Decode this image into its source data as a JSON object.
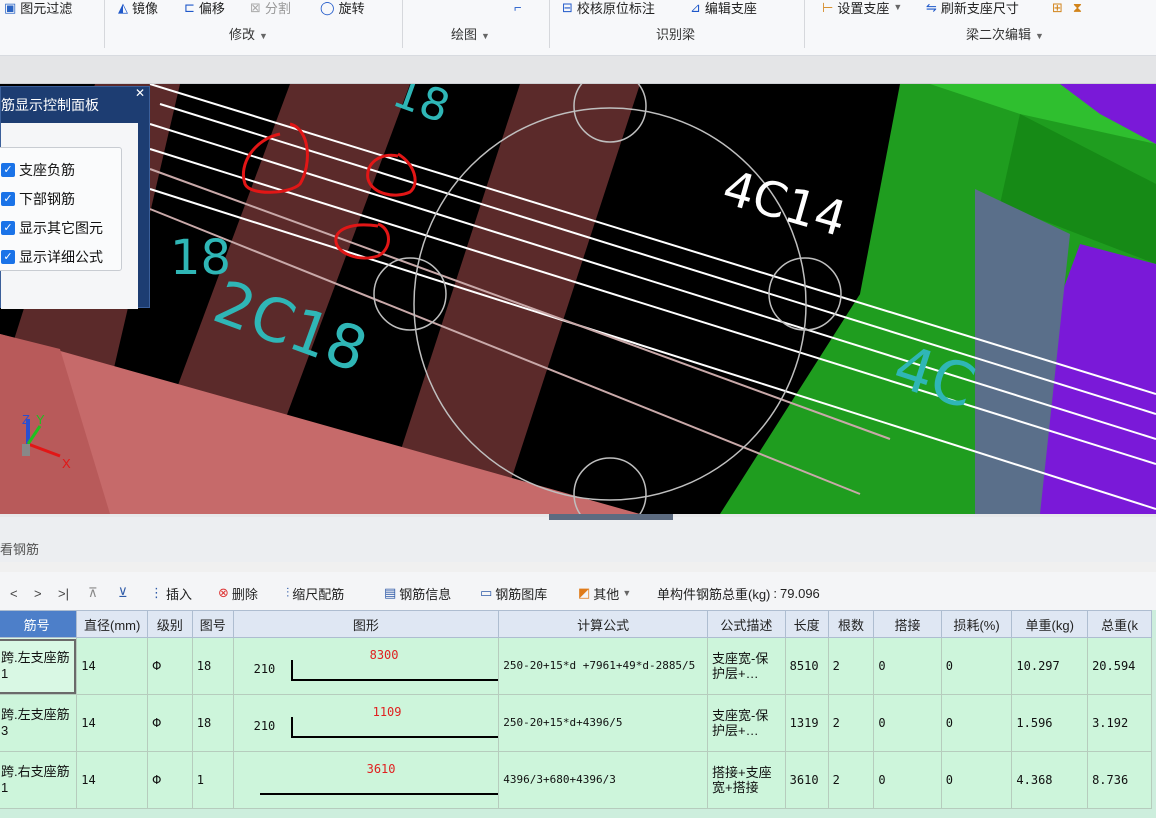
{
  "ribbon": {
    "items": [
      {
        "label": "图元过滤",
        "icon": "filter-icon"
      },
      {
        "label": "镜像",
        "icon": "mirror-icon"
      },
      {
        "label": "偏移",
        "icon": "offset-icon"
      },
      {
        "label": "分割",
        "icon": "split-icon"
      },
      {
        "label": "旋转",
        "icon": "rotate-icon"
      },
      {
        "label": "校核原位标注",
        "icon": "check-label-icon"
      },
      {
        "label": "编辑支座",
        "icon": "edit-support-icon"
      },
      {
        "label": "设置支座",
        "icon": "set-support-icon"
      },
      {
        "label": "刷新支座尺寸",
        "icon": "refresh-support-icon"
      }
    ],
    "groups": {
      "modify": "修改",
      "draw": "绘图",
      "identify_beam": "识别梁",
      "beam_secondary_edit": "梁二次编辑"
    }
  },
  "viewport": {
    "labels": {
      "main_rebar": "4C14",
      "rebar_left_1": "18",
      "rebar_left_2": "2C18",
      "rebar_right": "4C",
      "rebar_top": "18"
    },
    "axes": {
      "x": "X",
      "y": "Y",
      "z": "Z"
    },
    "colors": {
      "background": "#000000",
      "beam_pink": "#c66a6a",
      "column_brown": "#5b2a2a",
      "green_slab": "#1f9d1f",
      "purple_slab": "#7a19d8",
      "rebar_cyan": "#2fb6b6",
      "annotation_red": "#e21616"
    }
  },
  "control_panel": {
    "title": "筋显示控制面板",
    "checkboxes": [
      {
        "label": "支座负筋",
        "checked": true
      },
      {
        "label": "下部钢筋",
        "checked": true
      },
      {
        "label": "显示其它图元",
        "checked": true
      },
      {
        "label": "显示详细公式",
        "checked": true
      }
    ]
  },
  "lower_panel": {
    "title": "看钢筋"
  },
  "toolbar2": {
    "nav": [
      "<",
      ">",
      ">|"
    ],
    "insert": "插入",
    "delete": "删除",
    "scale_rebar": "缩尺配筋",
    "rebar_info": "钢筋信息",
    "rebar_library": "钢筋图库",
    "other": "其他",
    "total_weight_label": "单构件钢筋总重(kg)",
    "total_weight_value": "79.096"
  },
  "table": {
    "headers": [
      "筋号",
      "直径(mm)",
      "级别",
      "图号",
      "图形",
      "计算公式",
      "公式描述",
      "长度",
      "根数",
      "搭接",
      "损耗(%)",
      "单重(kg)",
      "总重(k"
    ],
    "rows": [
      {
        "name": "跨.左支座筋1",
        "diameter": "14",
        "grade": "Φ",
        "fig": "18",
        "shape_left": "210",
        "shape_mid": "8300",
        "formula": "250-20+15*d +7961+49*d-2885/5",
        "desc": "支座宽-保护层+…",
        "length": "8510",
        "count": "2",
        "lap": "0",
        "loss": "0",
        "unit_wt": "10.297",
        "total_wt": "20.594"
      },
      {
        "name": "跨.左支座筋3",
        "diameter": "14",
        "grade": "Φ",
        "fig": "18",
        "shape_left": "210",
        "shape_mid": "1109",
        "formula": "250-20+15*d+4396/5",
        "desc": "支座宽-保护层+…",
        "length": "1319",
        "count": "2",
        "lap": "0",
        "loss": "0",
        "unit_wt": "1.596",
        "total_wt": "3.192"
      },
      {
        "name": "跨.右支座筋1",
        "diameter": "14",
        "grade": "Φ",
        "fig": "1",
        "shape_left": "",
        "shape_mid": "3610",
        "formula": "4396/3+680+4396/3",
        "desc": "搭接+支座宽+搭接",
        "length": "3610",
        "count": "2",
        "lap": "0",
        "loss": "0",
        "unit_wt": "4.368",
        "total_wt": "8.736"
      }
    ]
  }
}
